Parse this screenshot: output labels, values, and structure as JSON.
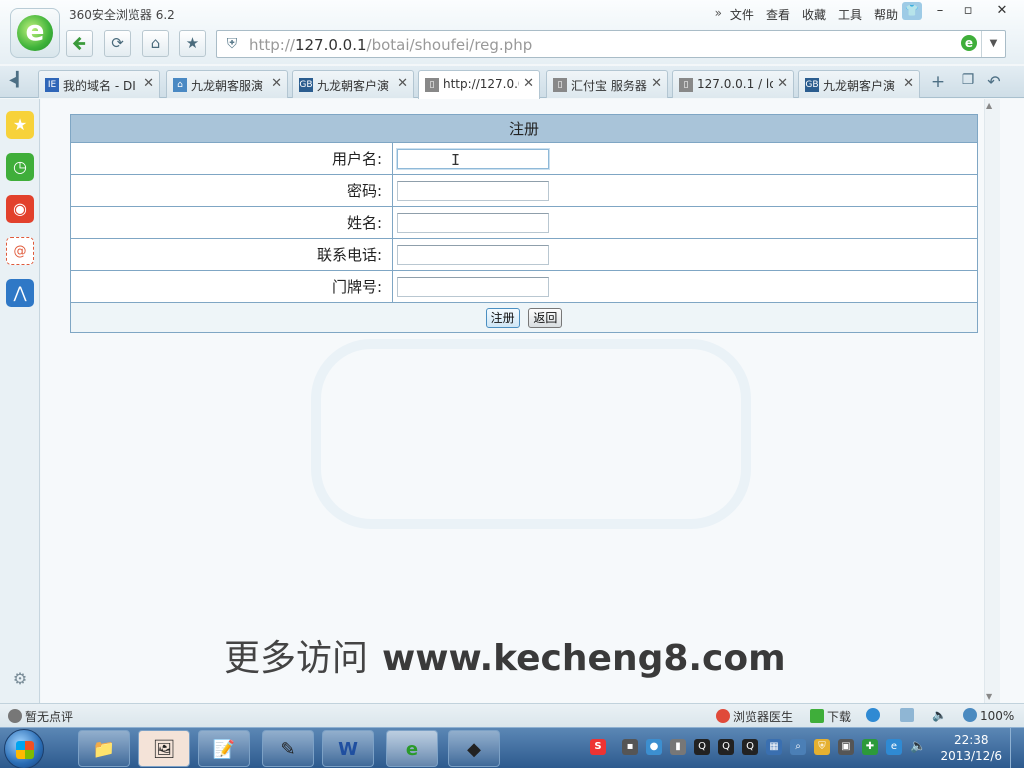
{
  "window": {
    "app_title": "360安全浏览器 6.2",
    "menu": {
      "overflow": "»",
      "file": "文件",
      "view": "查看",
      "favorites": "收藏",
      "tools": "工具",
      "help": "帮助"
    },
    "controls": {
      "minimize": "–",
      "restore": "▫",
      "close": "✕"
    }
  },
  "toolbar": {
    "address": {
      "scheme": "http://",
      "host": "127.0.0.1",
      "path": "/botai/shoufei/reg.php"
    }
  },
  "tabs": [
    {
      "label": "我的域名 - DI",
      "favicon": "IE",
      "favicon_color": "#2f66b8",
      "close": "✕",
      "active": false
    },
    {
      "label": "九龙朝客服演",
      "favicon": "⌂",
      "favicon_color": "#4a89c3",
      "close": "✕",
      "active": false
    },
    {
      "label": "九龙朝客户演",
      "favicon": "GB",
      "favicon_color": "#2b5d8f",
      "close": "✕",
      "active": false
    },
    {
      "label": "http://127.0.0",
      "favicon": "▯",
      "favicon_color": "#888888",
      "close": "✕",
      "active": true
    },
    {
      "label": "汇付宝 服务器",
      "favicon": "▯",
      "favicon_color": "#888888",
      "close": "✕",
      "active": false
    },
    {
      "label": "127.0.0.1 / lo",
      "favicon": "▯",
      "favicon_color": "#888888",
      "close": "✕",
      "active": false
    },
    {
      "label": "九龙朝客户演",
      "favicon": "GB",
      "favicon_color": "#2b5d8f",
      "close": "✕",
      "active": false
    }
  ],
  "form": {
    "title": "注册",
    "fields": [
      {
        "label": "用户名:",
        "value": "",
        "focused": true
      },
      {
        "label": "密码:",
        "value": "",
        "focused": false
      },
      {
        "label": "姓名:",
        "value": "",
        "focused": false
      },
      {
        "label": "联系电话:",
        "value": "",
        "focused": false
      },
      {
        "label": "门牌号:",
        "value": "",
        "focused": false
      }
    ],
    "submit_label": "注册",
    "back_label": "返回"
  },
  "watermark": {
    "cn": "更多访问",
    "url": "www.kecheng8.com"
  },
  "statusbar": {
    "rating": "暂无点评",
    "doctor": "浏览器医生",
    "download": "下载",
    "zoom": "100%"
  },
  "taskbar": {
    "time": "22:38",
    "date": "2013/12/6"
  },
  "colors": {
    "form_header": "#a9c4d9",
    "form_border": "#7fa6c4",
    "accent_green": "#3fb33a"
  }
}
